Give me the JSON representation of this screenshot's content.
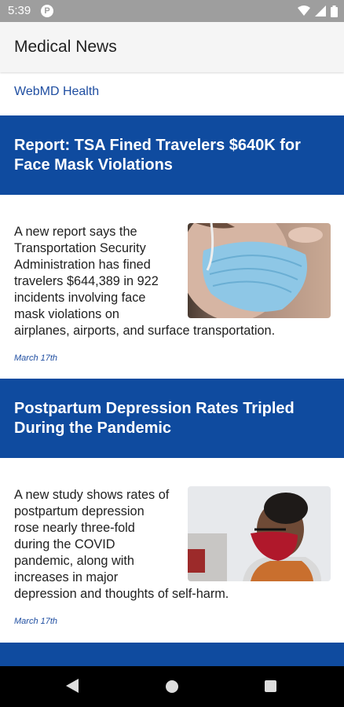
{
  "status_bar": {
    "time": "5:39",
    "app_icon_letter": "P"
  },
  "app_bar": {
    "title": "Medical News"
  },
  "source": {
    "label": "WebMD Health"
  },
  "articles": [
    {
      "title": "Report: TSA Fined Travelers $640K for Face Mask Violations",
      "summary_wrapped": "A new report says the Transportation Security Administration has fined travelers $644,389 in 922 incidents involving face mask violations on",
      "summary_tail": "airplanes, airports, and surface transportation.",
      "date": "March 17th",
      "image_desc": "person wearing blue surgical face mask"
    },
    {
      "title": "Postpartum Depression Rates Tripled During the Pandemic",
      "summary_wrapped": "A new study shows rates of postpartum depression rose nearly three-fold during the COVID pandemic, along with increases in major",
      "summary_tail": "depression and thoughts of self-harm.",
      "date": "March 17th",
      "image_desc": "woman wearing glasses and red face mask"
    }
  ],
  "colors": {
    "header_blue": "#0f4b9f",
    "link_blue": "#1f4ea1",
    "status_gray": "#9e9e9e"
  },
  "icons": [
    "wifi-icon",
    "signal-icon",
    "battery-icon",
    "back-icon",
    "home-icon",
    "recents-icon"
  ]
}
